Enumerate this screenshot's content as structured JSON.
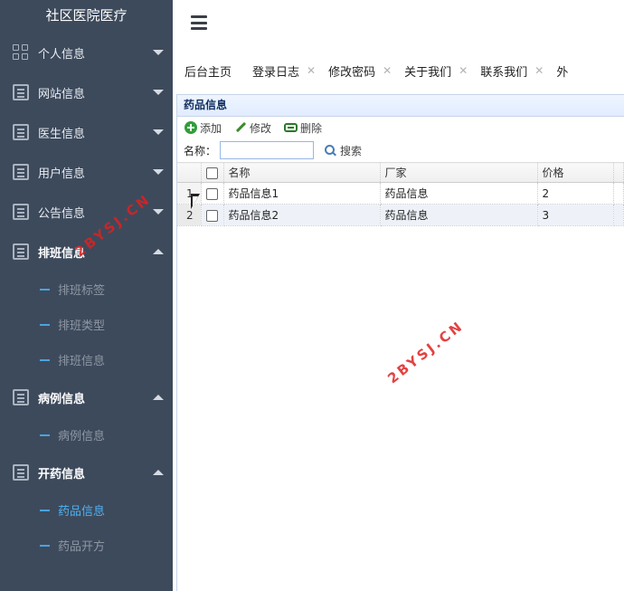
{
  "app": {
    "title": "社区医院医疗"
  },
  "sidebar": {
    "items": [
      {
        "label": "个人信息",
        "icon": "grid-icon",
        "expanded": false
      },
      {
        "label": "网站信息",
        "icon": "document-icon",
        "expanded": false
      },
      {
        "label": "医生信息",
        "icon": "document-icon",
        "expanded": false
      },
      {
        "label": "用户信息",
        "icon": "document-icon",
        "expanded": false
      },
      {
        "label": "公告信息",
        "icon": "document-icon",
        "expanded": false
      },
      {
        "label": "排班信息",
        "icon": "document-icon",
        "expanded": true,
        "children": [
          {
            "label": "排班标签"
          },
          {
            "label": "排班类型"
          },
          {
            "label": "排班信息"
          }
        ]
      },
      {
        "label": "病例信息",
        "icon": "document-icon",
        "expanded": true,
        "children": [
          {
            "label": "病例信息"
          }
        ]
      },
      {
        "label": "开药信息",
        "icon": "document-icon",
        "expanded": true,
        "children": [
          {
            "label": "药品信息",
            "active": true
          },
          {
            "label": "药品开方"
          }
        ]
      }
    ]
  },
  "tabs": [
    {
      "label": "后台主页"
    },
    {
      "label": "登录日志"
    },
    {
      "label": "修改密码"
    },
    {
      "label": "关于我们"
    },
    {
      "label": "联系我们"
    },
    {
      "label": "外"
    }
  ],
  "panel": {
    "title": "药品信息",
    "toolbar": {
      "add_label": "添加",
      "edit_label": "修改",
      "delete_label": "删除"
    },
    "search": {
      "label": "名称：",
      "value": "",
      "placeholder": "",
      "button_label": "搜索"
    },
    "table": {
      "columns": [
        "名称",
        "厂家",
        "价格"
      ],
      "rows": [
        {
          "rownum": "1",
          "name": "药品信息1",
          "maker": "药品信息",
          "price": "2"
        },
        {
          "rownum": "2",
          "name": "药品信息2",
          "maker": "药品信息",
          "price": "3"
        }
      ]
    }
  },
  "watermarks": [
    "2BYSJ.CN",
    "2BYSJ.CN"
  ],
  "colors": {
    "sidebar_bg": "#3d4a5c",
    "active_sub": "#4fb0f0",
    "accent_dash": "#4aa3e0",
    "watermark": "#e02020"
  }
}
